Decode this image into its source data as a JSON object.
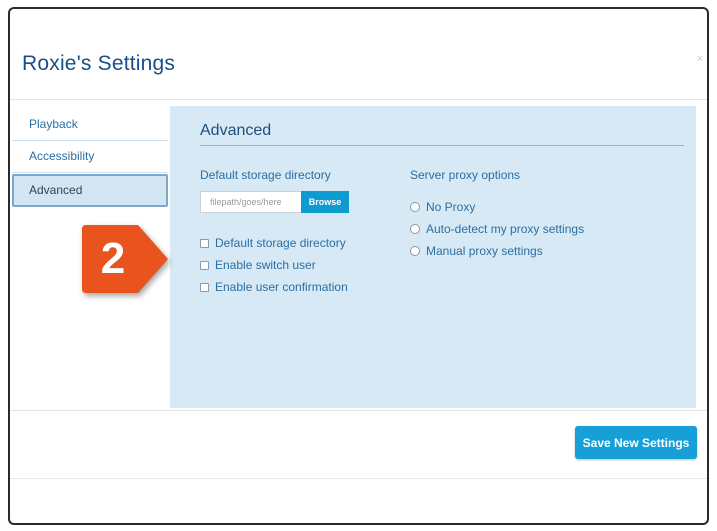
{
  "dialog": {
    "title": "Roxie's Settings",
    "close_glyph": "×"
  },
  "sidebar": {
    "items": [
      {
        "label": "Playback"
      },
      {
        "label": "Accessibility"
      },
      {
        "label": "Advanced",
        "active": true
      }
    ]
  },
  "panel": {
    "title": "Advanced",
    "storage": {
      "label": "Default storage directory",
      "input_placeholder": "filepath/goes/here",
      "input_value": "",
      "browse_label": "Browse"
    },
    "checkboxes": [
      {
        "label": "Default storage directory",
        "checked": false
      },
      {
        "label": "Enable switch user",
        "checked": false
      },
      {
        "label": "Enable user confirmation",
        "checked": false
      }
    ],
    "proxy": {
      "label": "Server proxy options",
      "options": [
        {
          "label": "No Proxy",
          "selected": false
        },
        {
          "label": "Auto-detect my proxy settings",
          "selected": false
        },
        {
          "label": "Manual proxy settings",
          "selected": false
        }
      ]
    }
  },
  "footer": {
    "save_label": "Save New Settings"
  },
  "callout": {
    "number": "2",
    "color": "#e8531e"
  },
  "colors": {
    "accent": "#17a0d8",
    "panel_bg": "#d6e9f4",
    "title_blue": "#1a4f86",
    "link_blue": "#2c6fa3"
  }
}
